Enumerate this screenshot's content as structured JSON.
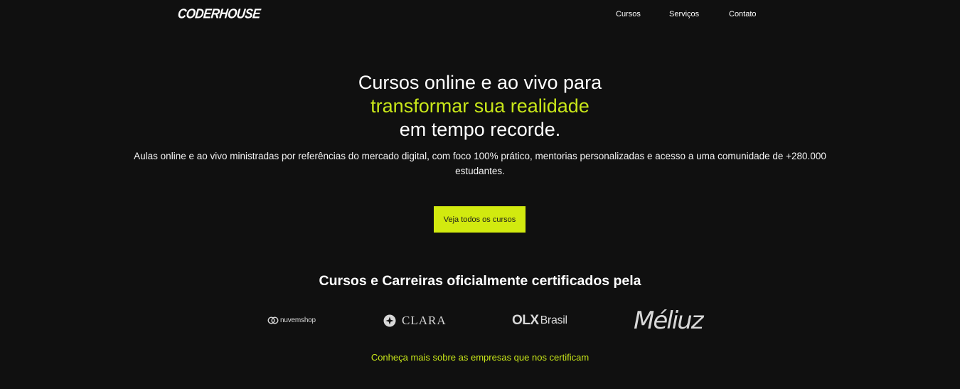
{
  "header": {
    "logo": "CODERHOUSE",
    "nav": [
      "Cursos",
      "Serviços",
      "Contato"
    ]
  },
  "hero": {
    "title_line1": "Cursos online e ao vivo para",
    "title_highlight": "transformar sua realidade",
    "title_line3": "em tempo recorde.",
    "subtitle": "Aulas online e ao vivo ministradas por referências do mercado digital, com foco 100% prático, mentorias personalizadas e acesso a uma comunidade de +280.000 estudantes.",
    "cta_label": "Veja todos os cursos"
  },
  "certification": {
    "title": "Cursos e Carreiras oficialmente certificados pela",
    "partners": [
      "nuvemshop",
      "CLARA",
      "OLX",
      "Brasil",
      "Méliuz"
    ],
    "link": "Conheça mais sobre as empresas que nos certificam"
  },
  "colors": {
    "background": "#101010",
    "accent": "#c8e619",
    "button": "#d2ea0f"
  }
}
